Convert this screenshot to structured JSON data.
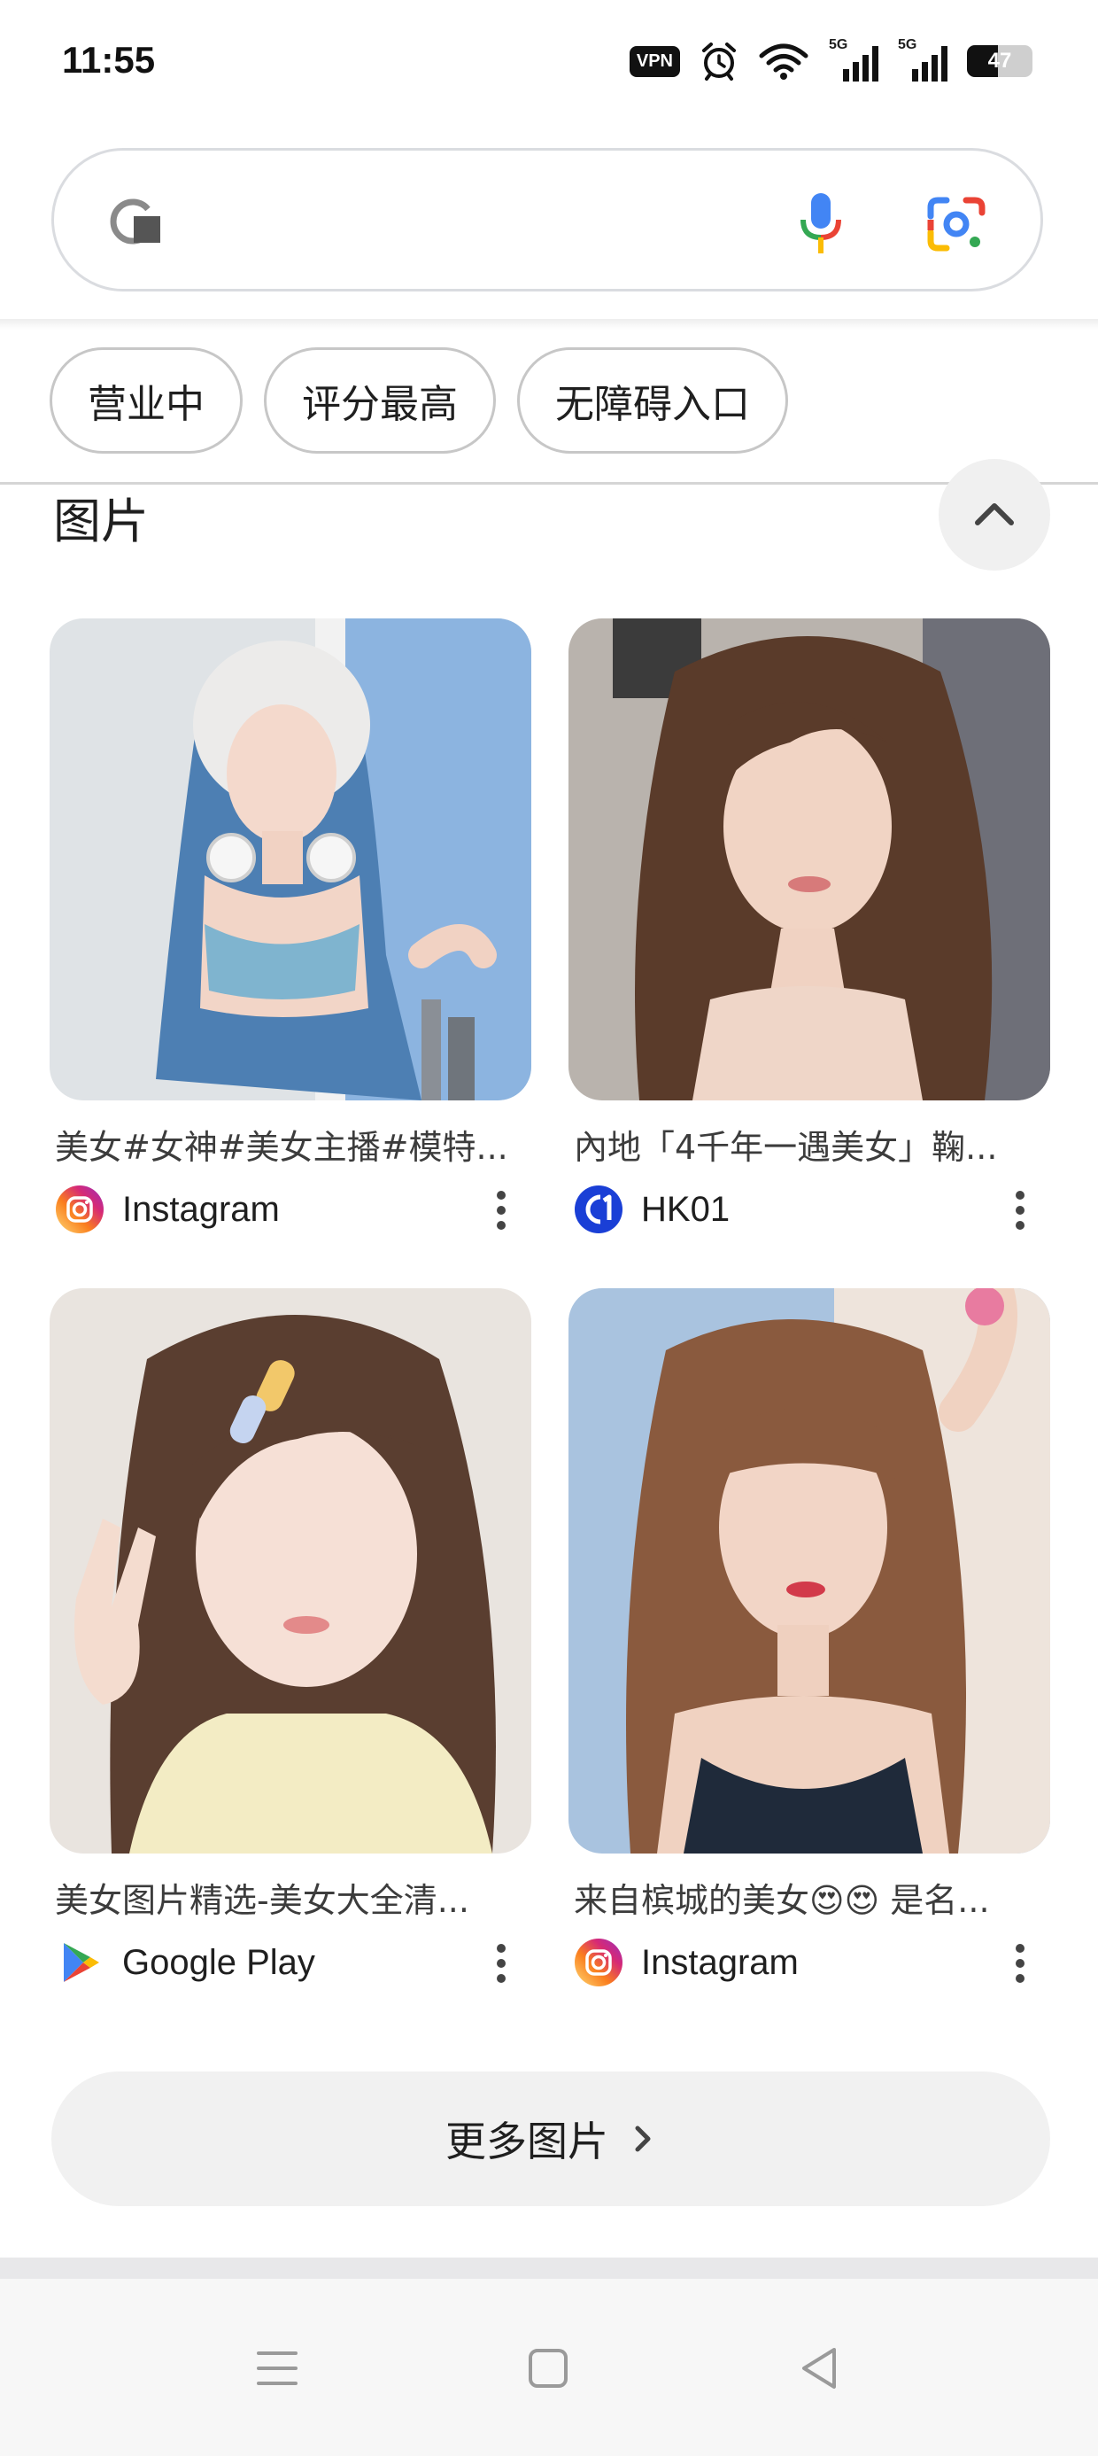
{
  "status_bar": {
    "time": "11:55",
    "vpn": "VPN",
    "signal_1": "5G",
    "signal_2": "5G",
    "battery": "47",
    "battery_level": 0.47
  },
  "search": {
    "placeholder": "",
    "value": ""
  },
  "chips": [
    "营业中",
    "评分最高",
    "无障碍入口"
  ],
  "images_section": {
    "title": "图片",
    "results": [
      {
        "caption": "美女#女神#美女主播#模特...",
        "source": "Instagram",
        "source_icon": "instagram-icon"
      },
      {
        "caption": "內地「4千年一遇美女」鞠...",
        "source": "HK01",
        "source_icon": "hk01-icon"
      },
      {
        "caption": "美女图片精选-美女大全清...",
        "source": "Google Play",
        "source_icon": "google-play-icon"
      },
      {
        "caption": "来自槟城的美女😍😍 是名...",
        "source": "Instagram",
        "source_icon": "instagram-icon"
      }
    ],
    "more_button": "更多图片"
  },
  "colors": {
    "instagram": "#d62976",
    "hk01": "#1a3fd6",
    "google_blue": "#4285f4",
    "google_red": "#ea4335",
    "google_yellow": "#fbbc05",
    "google_green": "#34a853"
  }
}
